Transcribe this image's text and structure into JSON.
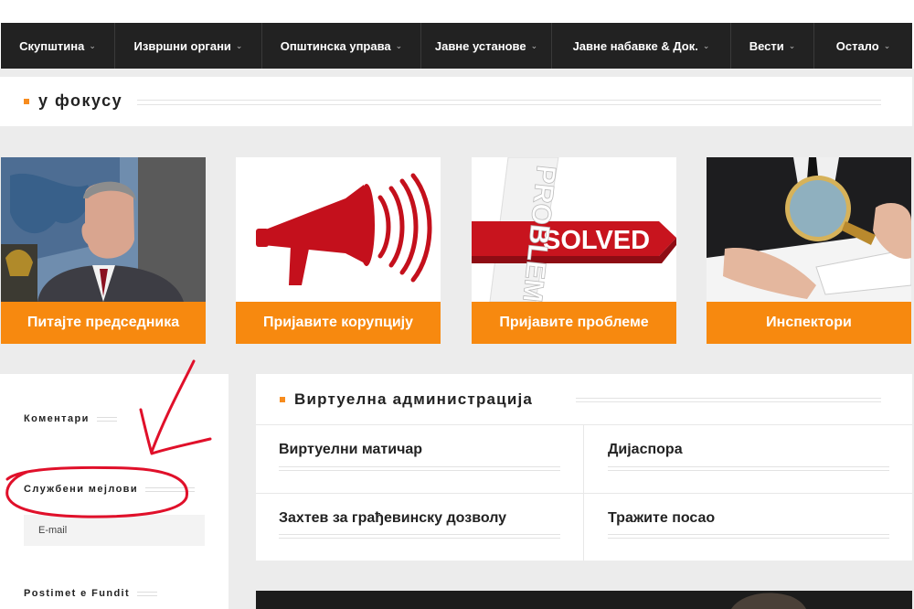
{
  "nav": {
    "items": [
      {
        "label": "Скупштина"
      },
      {
        "label": "Извршни органи"
      },
      {
        "label": "Општинска управа"
      },
      {
        "label": "Јавне установе"
      },
      {
        "label": "Јавне набавке & Док."
      },
      {
        "label": "Вести"
      },
      {
        "label": "Остало"
      }
    ],
    "caret_icon": "chevron-down-icon"
  },
  "focus": {
    "title": "у фокусу"
  },
  "cards": [
    {
      "label": "Питајте председника"
    },
    {
      "label": "Пријавите корупцију"
    },
    {
      "label": "Пријавите проблеме",
      "image_text_solved": "SOLVED",
      "image_text_problem": "PROBLEM"
    },
    {
      "label": "Инспектори"
    }
  ],
  "sidebar": {
    "comments_heading": "Коментари",
    "emails_heading": "Службени мејлови",
    "email_link": "E-mail",
    "recent_heading": "Postimet e Fundit"
  },
  "virtual": {
    "title": "Виртуелна администрација",
    "links": [
      {
        "label": "Виртуелни матичар"
      },
      {
        "label": "Дијаспора"
      },
      {
        "label": "Захтев за грађевинску дозволу"
      },
      {
        "label": "Тражите посао"
      }
    ]
  },
  "colors": {
    "accent": "#f7890f",
    "nav_bg": "#222222",
    "annotation": "#e0102a"
  }
}
